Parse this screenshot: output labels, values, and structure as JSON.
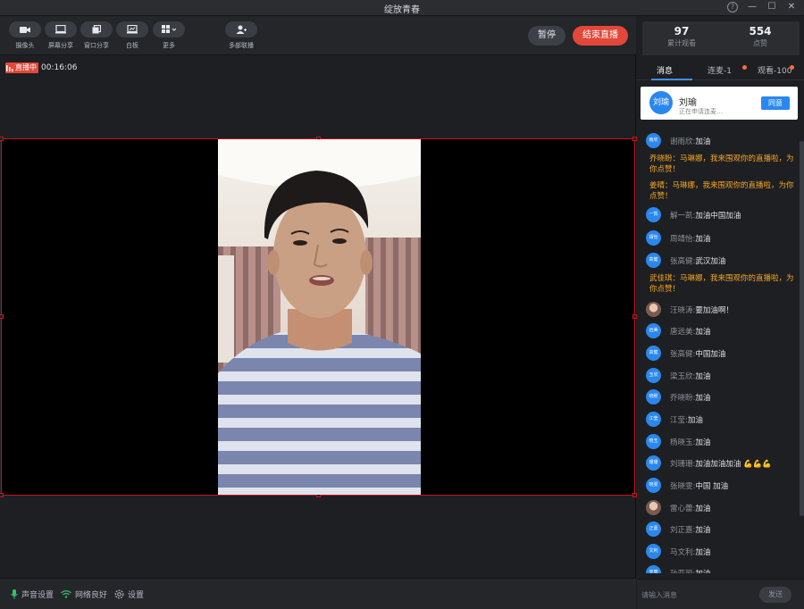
{
  "window": {
    "title": "绽放青春"
  },
  "toolbar": {
    "tools": [
      {
        "label": "摄像头",
        "icon": "camera-icon"
      },
      {
        "label": "屏幕分享",
        "icon": "screen-share-icon"
      },
      {
        "label": "窗口分享",
        "icon": "window-share-icon"
      },
      {
        "label": "白板",
        "icon": "whiteboard-icon"
      },
      {
        "label": "更多",
        "icon": "grid-icon"
      },
      {
        "label": "多部联播",
        "icon": "multi-stream-icon"
      }
    ],
    "pause_label": "暂停",
    "end_label": "结束直播"
  },
  "live": {
    "badge": "直播中",
    "time": "00:16:06"
  },
  "bottom": {
    "sound": "声音设置",
    "network": "网络良好",
    "settings": "设置"
  },
  "stats": {
    "views": "97",
    "views_label": "累计观看",
    "likes": "554",
    "likes_label": "点赞"
  },
  "tabs": {
    "messages": "消息",
    "connect": "连麦-1",
    "viewers": "观看-100"
  },
  "request": {
    "avatar": "刘瑜",
    "name": "刘瑜",
    "subtitle": "正在申请连麦…",
    "accept": "同意"
  },
  "messages": [
    {
      "type": "user",
      "avatar": "雨欣",
      "name": "谢雨欣:",
      "text": " 加油"
    },
    {
      "type": "system",
      "text": "乔晓盼：马琳娜，我来围观你的直播啦，为你点赞！"
    },
    {
      "type": "system",
      "text": "姜晴：马琳娜，我来围观你的直播啦，为你点赞！"
    },
    {
      "type": "user",
      "avatar": "一凯",
      "name": "解一凯:",
      "text": " 加油中国加油"
    },
    {
      "type": "user",
      "avatar": "靖怡",
      "name": "周靖怡:",
      "text": " 加油"
    },
    {
      "type": "user",
      "avatar": "高健",
      "name": "张高健:",
      "text": " 武汉加油"
    },
    {
      "type": "system",
      "text": "武佳琪：马琳娜，我来围观你的直播啦，为你点赞！"
    },
    {
      "type": "user",
      "avatar": "",
      "photo": true,
      "name": "汪晓涛:",
      "text": " 要加油啊！"
    },
    {
      "type": "user",
      "avatar": "远美",
      "name": "唐远美:",
      "text": " 加油"
    },
    {
      "type": "user",
      "avatar": "高健",
      "name": "张高健:",
      "text": " 中国加油"
    },
    {
      "type": "user",
      "avatar": "玉欣",
      "name": "梁玉欣:",
      "text": " 加油"
    },
    {
      "type": "user",
      "avatar": "晓盼",
      "name": "乔晓盼:",
      "text": " 加油"
    },
    {
      "type": "user",
      "avatar": "江莹",
      "name": "江莹:",
      "text": " 加油"
    },
    {
      "type": "user",
      "avatar": "晓玉",
      "name": "杨晓玉:",
      "text": " 加油"
    },
    {
      "type": "user",
      "avatar": "珊珊",
      "name": "刘珊珊:",
      "text": " 加油加油加油 💪💪💪"
    },
    {
      "type": "user",
      "avatar": "晓雯",
      "name": "张晓雯:",
      "text": " 中国  加油"
    },
    {
      "type": "user",
      "avatar": "",
      "photo": true,
      "name": "雷心蕾:",
      "text": " 加油"
    },
    {
      "type": "user",
      "avatar": "正嘉",
      "name": "刘正嘉:",
      "text": " 加油"
    },
    {
      "type": "user",
      "avatar": "文利",
      "name": "马文利:",
      "text": " 加油"
    },
    {
      "type": "user",
      "avatar": "亚丽",
      "name": "孙亚丽:",
      "text": " 加油"
    }
  ],
  "input": {
    "placeholder": "请输入消息",
    "send": "发送"
  },
  "colors": {
    "accent": "#2a87ee",
    "danger": "#e2473a",
    "system_text": "#f5a623"
  }
}
